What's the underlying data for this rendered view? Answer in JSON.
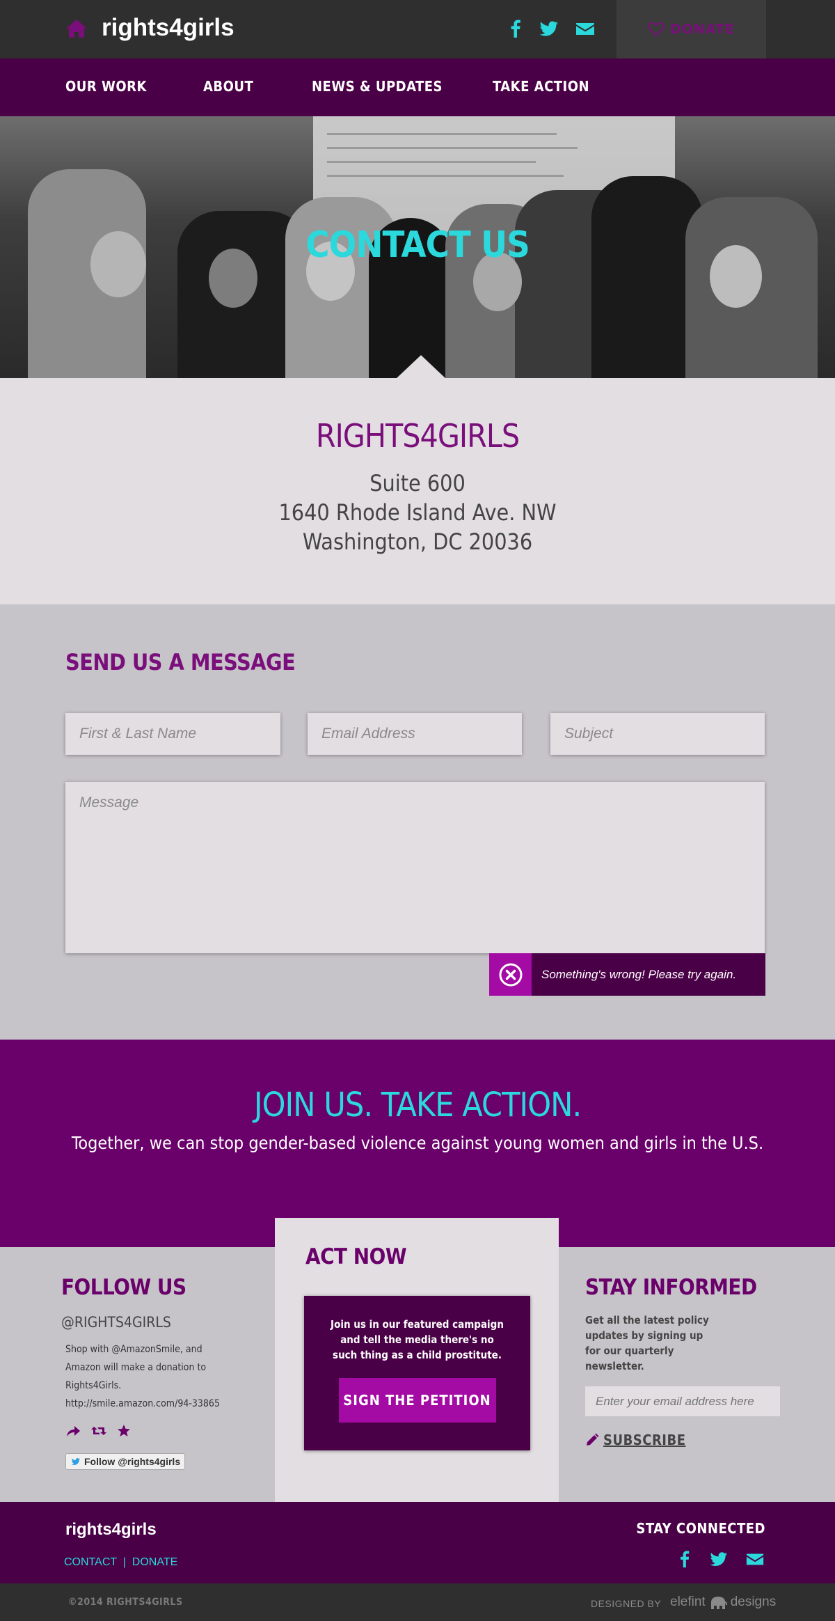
{
  "header": {
    "brand": "rights4girls",
    "donate_label": "DONATE",
    "social_icons": [
      "facebook-icon",
      "twitter-icon",
      "email-icon"
    ]
  },
  "nav": {
    "items": [
      {
        "label": "OUR WORK"
      },
      {
        "label": "ABOUT"
      },
      {
        "label": "NEWS & UPDATES"
      },
      {
        "label": "TAKE ACTION"
      }
    ]
  },
  "hero": {
    "title": "CONTACT US"
  },
  "address": {
    "org": "RIGHTS4GIRLS",
    "line1": "Suite 600",
    "line2": "1640 Rhode Island Ave. NW",
    "line3": "Washington, DC 20036"
  },
  "message_form": {
    "heading": "SEND US A MESSAGE",
    "name_placeholder": "First & Last Name",
    "email_placeholder": "Email Address",
    "subject_placeholder": "Subject",
    "message_placeholder": "Message",
    "error_text": "Something's wrong! Please try again."
  },
  "join": {
    "title": "JOIN US. TAKE ACTION.",
    "subtitle": "Together, we can stop gender-based violence against young women and girls in the U.S."
  },
  "follow": {
    "heading": "FOLLOW US",
    "handle": "@RIGHTS4GIRLS",
    "tweet": "Shop with @AmazonSmile, and Amazon will make a donation to Rights4Girls. http://smile.amazon.com/94-33865",
    "follow_button": "Follow @rights4girls"
  },
  "act_now": {
    "heading": "ACT NOW",
    "card_text": "Join us in our featured campaign and tell the media there's no such thing as a child prostitute.",
    "button_label": "SIGN THE PETITION"
  },
  "stay_informed": {
    "heading": "STAY INFORMED",
    "description": "Get all the latest policy updates by signing up for our quarterly newsletter.",
    "email_placeholder": "Enter your email address here",
    "subscribe_label": "SUBSCRIBE"
  },
  "footer": {
    "brand": "rights4girls",
    "contact_label": "CONTACT",
    "separator": "|",
    "donate_label": "DONATE",
    "stay_connected": "STAY CONNECTED"
  },
  "bottom": {
    "copyright": "©2014 RIGHTS4GIRLS",
    "designed_by": "DESIGNED BY",
    "studio_left": "elefint",
    "studio_right": "designs"
  },
  "colors": {
    "purple_dark": "#4a0046",
    "purple": "#6a006a",
    "magenta": "#a40aa4",
    "accent_cyan": "#2bd8dc",
    "light_bg": "#e2dee2",
    "grey_bg": "#c6c4c9",
    "charcoal": "#2f2f2f"
  }
}
